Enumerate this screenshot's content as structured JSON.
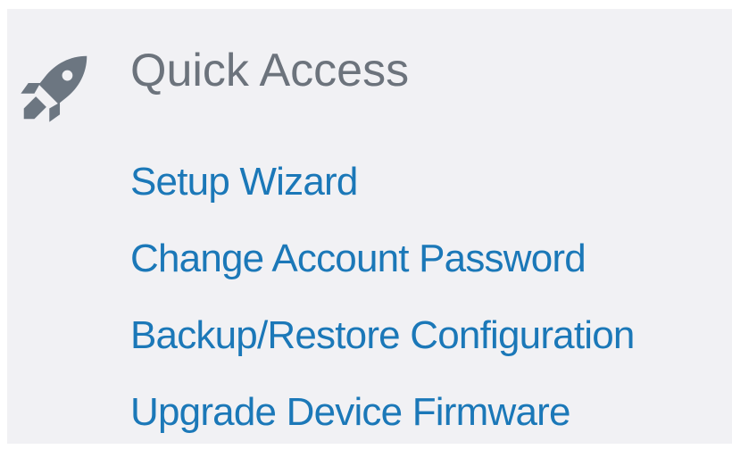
{
  "quick_access": {
    "title": "Quick Access",
    "icon": "rocket-icon",
    "colors": {
      "title": "#6c737c",
      "link": "#1b78b8",
      "icon": "#6c7681",
      "background": "#f1f1f4"
    },
    "links": [
      {
        "label": "Setup Wizard"
      },
      {
        "label": "Change Account Password"
      },
      {
        "label": "Backup/Restore Configuration"
      },
      {
        "label": "Upgrade Device Firmware"
      }
    ]
  }
}
